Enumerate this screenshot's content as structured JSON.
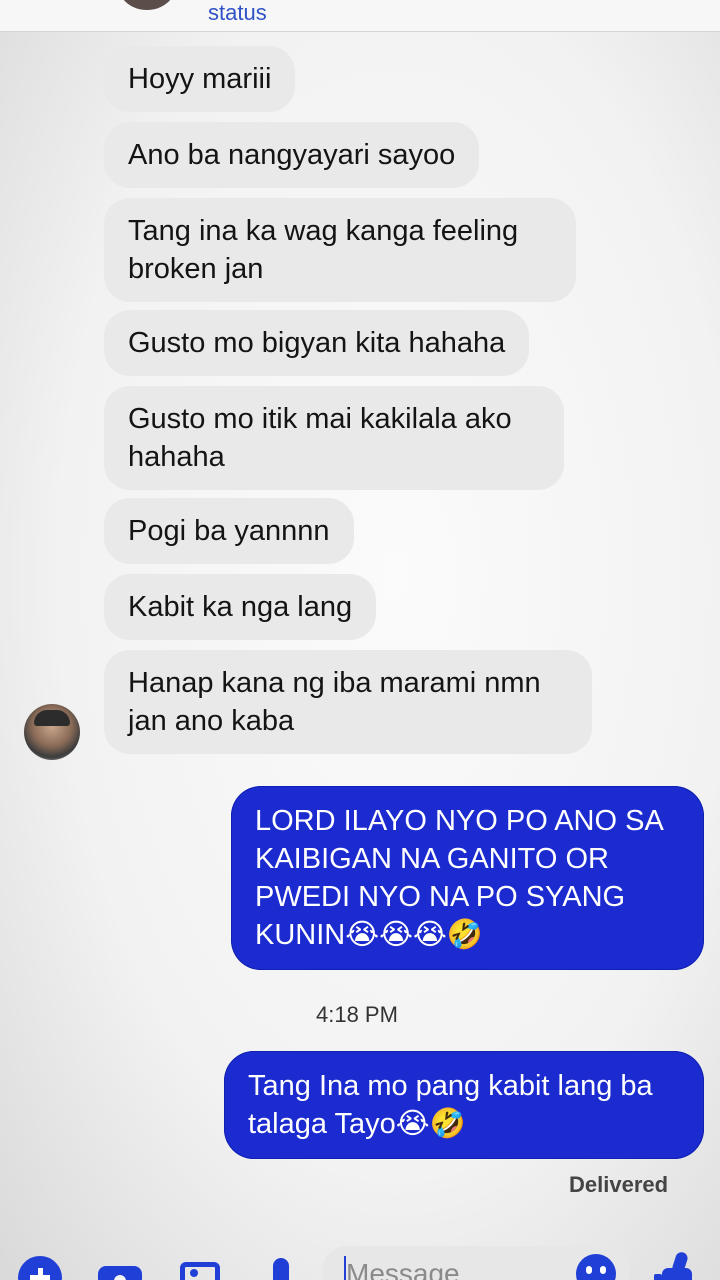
{
  "header": {
    "status": "status"
  },
  "messages_in": [
    "Hoyy mariii",
    "Ano ba nangyayari sayoo",
    "Tang ina ka wag kanga  feeling broken jan",
    "Gusto mo bigyan kita hahaha",
    "Gusto mo itik mai kakilala ako hahaha",
    "Pogi ba yannnn",
    "Kabit ka nga lang",
    "Hanap kana ng iba marami nmn jan ano kaba"
  ],
  "messages_out": [
    "LORD ILAYO NYO PO ANO SA KAIBIGAN NA GANITO OR PWEDI NYO NA PO SYANG KUNIN😭😭😭🤣",
    "Tang Ina mo pang kabit lang ba talaga Tayo😭🤣"
  ],
  "timestamp": "4:18 PM",
  "delivered": "Delivered",
  "composer": {
    "placeholder": "Message"
  },
  "colors": {
    "outgoing": "#1b2bd0",
    "incoming": "#e9e9e9",
    "accent": "#1f3fd6"
  },
  "icons": [
    "plus-icon",
    "camera-icon",
    "photo-icon",
    "mic-icon",
    "emoji-icon",
    "like-icon"
  ]
}
